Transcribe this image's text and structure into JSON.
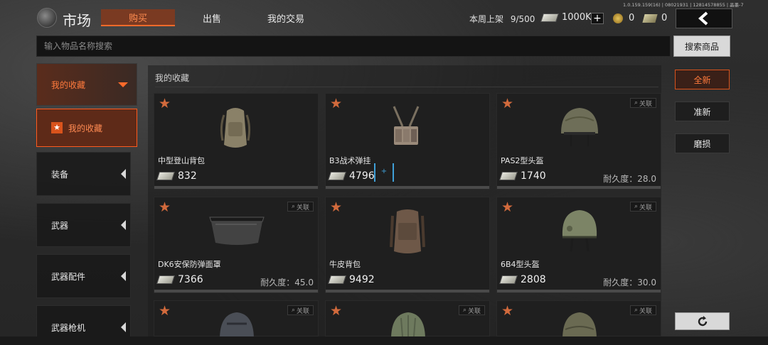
{
  "version": "1.0.159.159(16) | 08021931 | 12814578855 | 晶墨-7",
  "header": {
    "title": "市场",
    "tabs": [
      {
        "label": "购买",
        "active": true
      },
      {
        "label": "出售",
        "active": false
      },
      {
        "label": "我的交易",
        "active": false
      }
    ],
    "weekly_listing_label": "本周上架",
    "weekly_listing_value": "9/500",
    "money": "1000K",
    "coins": "0",
    "tickets": "0"
  },
  "search": {
    "placeholder": "输入物品名称搜索",
    "button_label": "搜索商品"
  },
  "sidebar": {
    "header_label": "我的收藏",
    "active_item": "我的收藏",
    "items": [
      {
        "label": "装备"
      },
      {
        "label": "武器"
      },
      {
        "label": "武器配件"
      },
      {
        "label": "武器枪机"
      }
    ]
  },
  "content": {
    "section_title": "我的收藏",
    "link_label": "关联",
    "items": [
      {
        "name": "中型登山背包",
        "price": "832",
        "durability": ""
      },
      {
        "name": "B3战术弹挂",
        "price": "4796",
        "durability": ""
      },
      {
        "name": "PAS2型头盔",
        "price": "1740",
        "durability": "耐久度：28.0"
      },
      {
        "name": "DK6安保防弹面罩",
        "price": "7366",
        "durability": "耐久度：45.0"
      },
      {
        "name": "牛皮背包",
        "price": "9492",
        "durability": ""
      },
      {
        "name": "6B4型头盔",
        "price": "2808",
        "durability": "耐久度：30.0"
      }
    ],
    "compare_symbol": "+"
  },
  "filters": [
    {
      "label": "全新",
      "active": true
    },
    {
      "label": "准新",
      "active": false
    },
    {
      "label": "磨损",
      "active": false
    }
  ],
  "colors": {
    "accent": "#ff6a2a",
    "accent_bg": "#5e2a18",
    "star": "#d26a3c",
    "compare": "#3fa0d8"
  }
}
